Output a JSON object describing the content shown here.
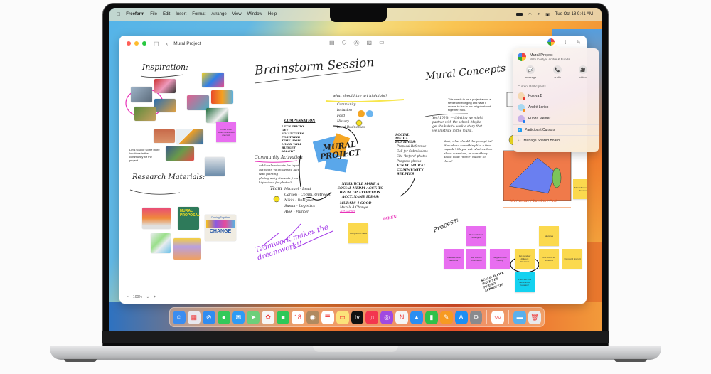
{
  "menubar": {
    "apple_icon": "apple-logo-icon",
    "app_name": "Freeform",
    "items": [
      "File",
      "Edit",
      "Insert",
      "Format",
      "Arrange",
      "View",
      "Window",
      "Help"
    ],
    "clock": "Tue Oct 18  9:41 AM",
    "status_icons": [
      "battery-icon",
      "wifi-icon",
      "search-icon",
      "control-center-icon"
    ]
  },
  "window": {
    "title": "Mural Project",
    "traffic_lights": {
      "close": "#ff5f57",
      "minimize": "#febc2e",
      "zoom": "#28c840"
    },
    "toolbar_center_icons": [
      "sticky-note-icon",
      "shapes-icon",
      "text-box-icon",
      "media-icon",
      "files-icon"
    ],
    "toolbar_right_icons": [
      "collaborators-icon",
      "share-icon",
      "new-board-icon"
    ],
    "zoom_level": "100%",
    "zoom_minus": "−",
    "zoom_plus": "+"
  },
  "board": {
    "headings": {
      "inspiration": "Inspiration:",
      "brainstorm": "Brainstorm Session",
      "mural_concepts": "Mural Concepts",
      "research": "Research Materials:",
      "process": "Process:"
    },
    "notes": {
      "locations": "Let's source some more locations in the community for the project.",
      "belonging": "This needs to be a project about a sense of belonging and what it means to live in our neighborhood, together, now.",
      "compensation_title": "COMPENSATION",
      "compensation_body": "LET'S TRY TO GET VOLUNTEERS FOR THEIR TIME. HOW MUCH WILL BUDGET ALLOW?",
      "art_highlight_title": "what should the art highlight?",
      "art_highlight_items": [
        "Community",
        "Inclusion",
        "Food",
        "History",
        "Local Businesses"
      ],
      "social_media_title": "SOCIAL MEDIA POSTINGS:",
      "social_media_items": [
        "Proposal Reference",
        "Call for Submissions",
        "Site \"before\" photos",
        "Progress photos",
        "FINAL MURAL COMMUNITY SELFIES"
      ],
      "community_activation_title": "Community Activation",
      "community_activation_items": [
        "ask local residents for input",
        "get youth volunteers to help with painting",
        "photography students from highschool for photos?"
      ],
      "mural_project_logo": "MURAL PROJECT",
      "team_title": "Team",
      "team_items": [
        "Michael - Lead",
        "Carson - Comm. Outreach",
        "Nikki - Designer",
        "Susan - Logistics",
        "Alok - Painter"
      ],
      "neha_note": "NEHA WILL MAKE A SOCIAL MEDIA ACCT. TO DRUM UP ATTENTION. ACCT. NAME IDEAS:",
      "acct_ideas": [
        "MURALS 4 GOOD",
        "Murals 4 Change",
        "ArtForAll"
      ],
      "taken": "TAKEN",
      "teamwork": "Teamwork makes the dreamwork!!",
      "yes_note": "Yes! 100%! — thinking we might partner with the school. Maybe get the kids to work a story that we illustrate in the mural.",
      "yeah_note": "Yeah, what should the prompt be? How about something like a time capsule? Maybe ask what we love about ourselves, or something about what \"home\" means to them?",
      "mural_caption": "4th Avenue / Lambert Park",
      "side_note": "Mural Theme sets the tone",
      "scale_note": "SCALE: DO WE HAVE THE PERMIT APPROVED?"
    },
    "stickies": [
      {
        "text": "These brush stroke references are cool!",
        "color": "pink"
      },
      {
        "text": "Assigned to Neha",
        "color": "yellow"
      },
      {
        "text": "Research local ecologies",
        "color": "pink"
      },
      {
        "text": "Interview local residents",
        "color": "pink"
      },
      {
        "text": "Site specific information",
        "color": "pink"
      },
      {
        "text": "Neighborhood history",
        "color": "pink"
      },
      {
        "text": "Sketches",
        "color": "yellow"
      },
      {
        "text": "1st round w/ different directions",
        "color": "yellow"
      },
      {
        "text": "2nd round w/ revisions",
        "color": "yellow"
      },
      {
        "text": "3rd round final art",
        "color": "yellow"
      },
      {
        "text": "Paint the final mural art on location!",
        "color": "cyan"
      }
    ],
    "research_cards": {
      "proposal": "MURAL PROPOSAL",
      "change_top": "Coming   Together",
      "change": "CHANGE"
    }
  },
  "popover": {
    "title": "Mural Project",
    "subtitle": "With Kostya, André & Funda",
    "actions": [
      {
        "label": "message",
        "icon": "message-icon",
        "glyph": "💬"
      },
      {
        "label": "audio",
        "icon": "phone-icon",
        "glyph": "📞"
      },
      {
        "label": "video",
        "icon": "video-icon",
        "glyph": "🎥"
      }
    ],
    "section_label": "Current Participants",
    "participants": [
      {
        "name": "Kostya B",
        "status_color": "#e8352b"
      },
      {
        "name": "André Lorico",
        "status_color": "#f5901e"
      },
      {
        "name": "Funda Mehter",
        "status_color": "#1e7bf0"
      }
    ],
    "cursor_toggle": "Participant Cursors",
    "cursor_toggle_checked": true,
    "manage_label": "Manage Shared Board"
  },
  "dock": {
    "apps": [
      {
        "name": "Finder",
        "icon": "finder-icon",
        "color": "#3b8df0",
        "glyph": "☺"
      },
      {
        "name": "Launchpad",
        "icon": "launchpad-icon",
        "color": "#e8e8ee",
        "glyph": "▦"
      },
      {
        "name": "Safari",
        "icon": "safari-icon",
        "color": "#2f8cf0",
        "glyph": "⊘"
      },
      {
        "name": "Messages",
        "icon": "messages-icon",
        "color": "#32c95a",
        "glyph": "●"
      },
      {
        "name": "Mail",
        "icon": "mail-icon",
        "color": "#2f9bf5",
        "glyph": "✉"
      },
      {
        "name": "Maps",
        "icon": "maps-icon",
        "color": "#6dcf7a",
        "glyph": "➤"
      },
      {
        "name": "Photos",
        "icon": "photos-icon",
        "color": "#f6f6f6",
        "glyph": "✿"
      },
      {
        "name": "FaceTime",
        "icon": "facetime-icon",
        "color": "#2ec858",
        "glyph": "■"
      },
      {
        "name": "Calendar",
        "icon": "calendar-icon",
        "color": "#ffffff",
        "glyph": "18"
      },
      {
        "name": "Contacts",
        "icon": "contacts-icon",
        "color": "#b08a60",
        "glyph": "◉"
      },
      {
        "name": "Reminders",
        "icon": "reminders-icon",
        "color": "#ffffff",
        "glyph": "☰"
      },
      {
        "name": "Notes",
        "icon": "notes-icon",
        "color": "#fbe27a",
        "glyph": "▭"
      },
      {
        "name": "TV",
        "icon": "tv-icon",
        "color": "#111111",
        "glyph": "tv"
      },
      {
        "name": "Music",
        "icon": "music-icon",
        "color": "#f3364f",
        "glyph": "♫"
      },
      {
        "name": "Podcasts",
        "icon": "podcasts-icon",
        "color": "#a04ae0",
        "glyph": "◎"
      },
      {
        "name": "News",
        "icon": "news-icon",
        "color": "#f5f5f5",
        "glyph": "N"
      },
      {
        "name": "Keynote",
        "icon": "keynote-icon",
        "color": "#2c8ef2",
        "glyph": "▲"
      },
      {
        "name": "Numbers",
        "icon": "numbers-icon",
        "color": "#30c04a",
        "glyph": "▮"
      },
      {
        "name": "Pages",
        "icon": "pages-icon",
        "color": "#f79a22",
        "glyph": "✎"
      },
      {
        "name": "App Store",
        "icon": "app-store-icon",
        "color": "#1e8ef3",
        "glyph": "A"
      },
      {
        "name": "System Settings",
        "icon": "system-settings-icon",
        "color": "#8a8a8e",
        "glyph": "⚙"
      }
    ],
    "running_app": {
      "name": "Freeform",
      "icon": "freeform-icon",
      "color": "#ffffff",
      "glyph": "〰"
    },
    "extras": [
      {
        "name": "Downloads",
        "icon": "downloads-folder-icon",
        "color": "#5ab0ec",
        "glyph": "▬"
      },
      {
        "name": "Trash",
        "icon": "trash-icon",
        "color": "#e8eaec",
        "glyph": "🗑"
      }
    ]
  }
}
